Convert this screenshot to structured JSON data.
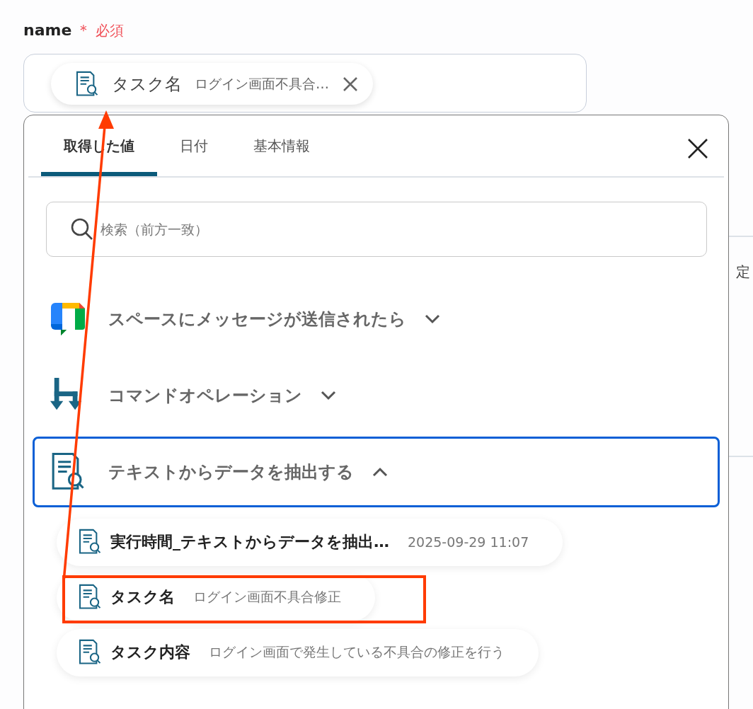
{
  "field": {
    "label": "name",
    "required_mark": "＊",
    "required_text": "必須",
    "chip": {
      "label": "タスク名",
      "value": "ログイン画面不具合…"
    }
  },
  "popup": {
    "tabs": [
      {
        "label": "取得した値",
        "selected": true
      },
      {
        "label": "日付",
        "selected": false
      },
      {
        "label": "基本情報",
        "selected": false
      }
    ],
    "search": {
      "placeholder": "検索（前方一致）"
    },
    "sections": [
      {
        "kind": "chat",
        "title": "スペースにメッセージが送信されたら",
        "expanded": false,
        "selected": false
      },
      {
        "kind": "command",
        "title": "コマンドオペレーション",
        "expanded": false,
        "selected": false
      },
      {
        "kind": "extract",
        "title": "テキストからデータを抽出する",
        "expanded": true,
        "selected": true
      }
    ],
    "items": [
      {
        "label": "実行時間_テキストからデータを抽出…",
        "value": "2025-09-29 11:07",
        "highlighted": false
      },
      {
        "label": "タスク名",
        "value": "ログイン画面不具合修正",
        "highlighted": true
      },
      {
        "label": "タスク内容",
        "value": "ログイン画面で発生している不具合の修正を行う",
        "highlighted": false
      }
    ]
  },
  "background_panel": {
    "text": "定"
  },
  "annotation_arrow": true
}
